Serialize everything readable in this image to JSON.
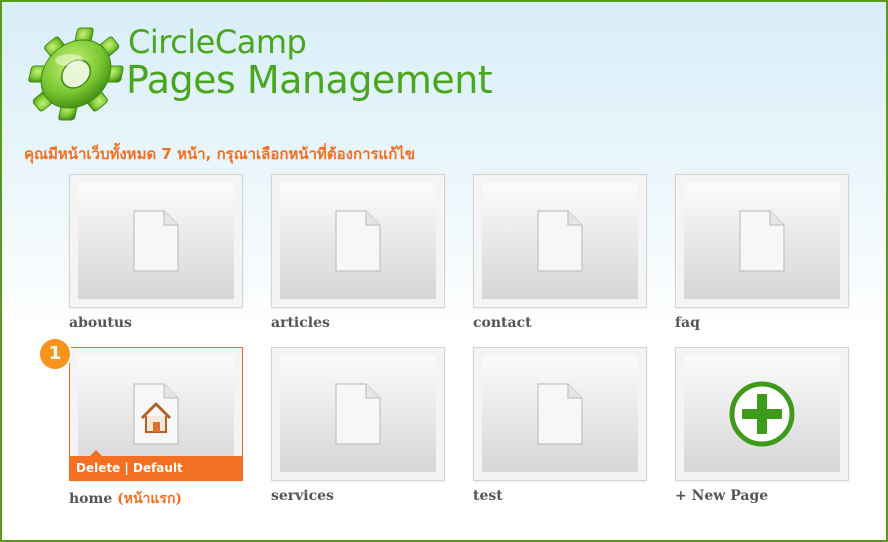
{
  "header": {
    "brand_line1": "CircleCamp",
    "brand_line2": "Pages Management",
    "logo_icon": "gear-logo-icon"
  },
  "prompt": "คุณมีหน้าเว็บทั้งหมด 7 หน้า, กรุณาเลือกหน้าที่ต้องการแก้ไข",
  "pages": [
    {
      "label": "aboutus",
      "icon": "document-icon"
    },
    {
      "label": "articles",
      "icon": "document-icon"
    },
    {
      "label": "contact",
      "icon": "document-icon"
    },
    {
      "label": "faq",
      "icon": "document-icon"
    },
    {
      "label": "home",
      "sublabel": "(หน้าแรก)",
      "icon": "home-document-icon",
      "selected": true,
      "actions": [
        "Delete",
        "Default"
      ],
      "action_separator": " | "
    },
    {
      "label": "services",
      "icon": "document-icon"
    },
    {
      "label": "test",
      "icon": "document-icon"
    }
  ],
  "new_page": {
    "label": "+ New Page",
    "icon": "plus-circle-icon"
  },
  "step_badge": "1",
  "colors": {
    "accent": "#f36f21",
    "brand_green": "#4aa61e",
    "border_green": "#5a9a1a"
  }
}
